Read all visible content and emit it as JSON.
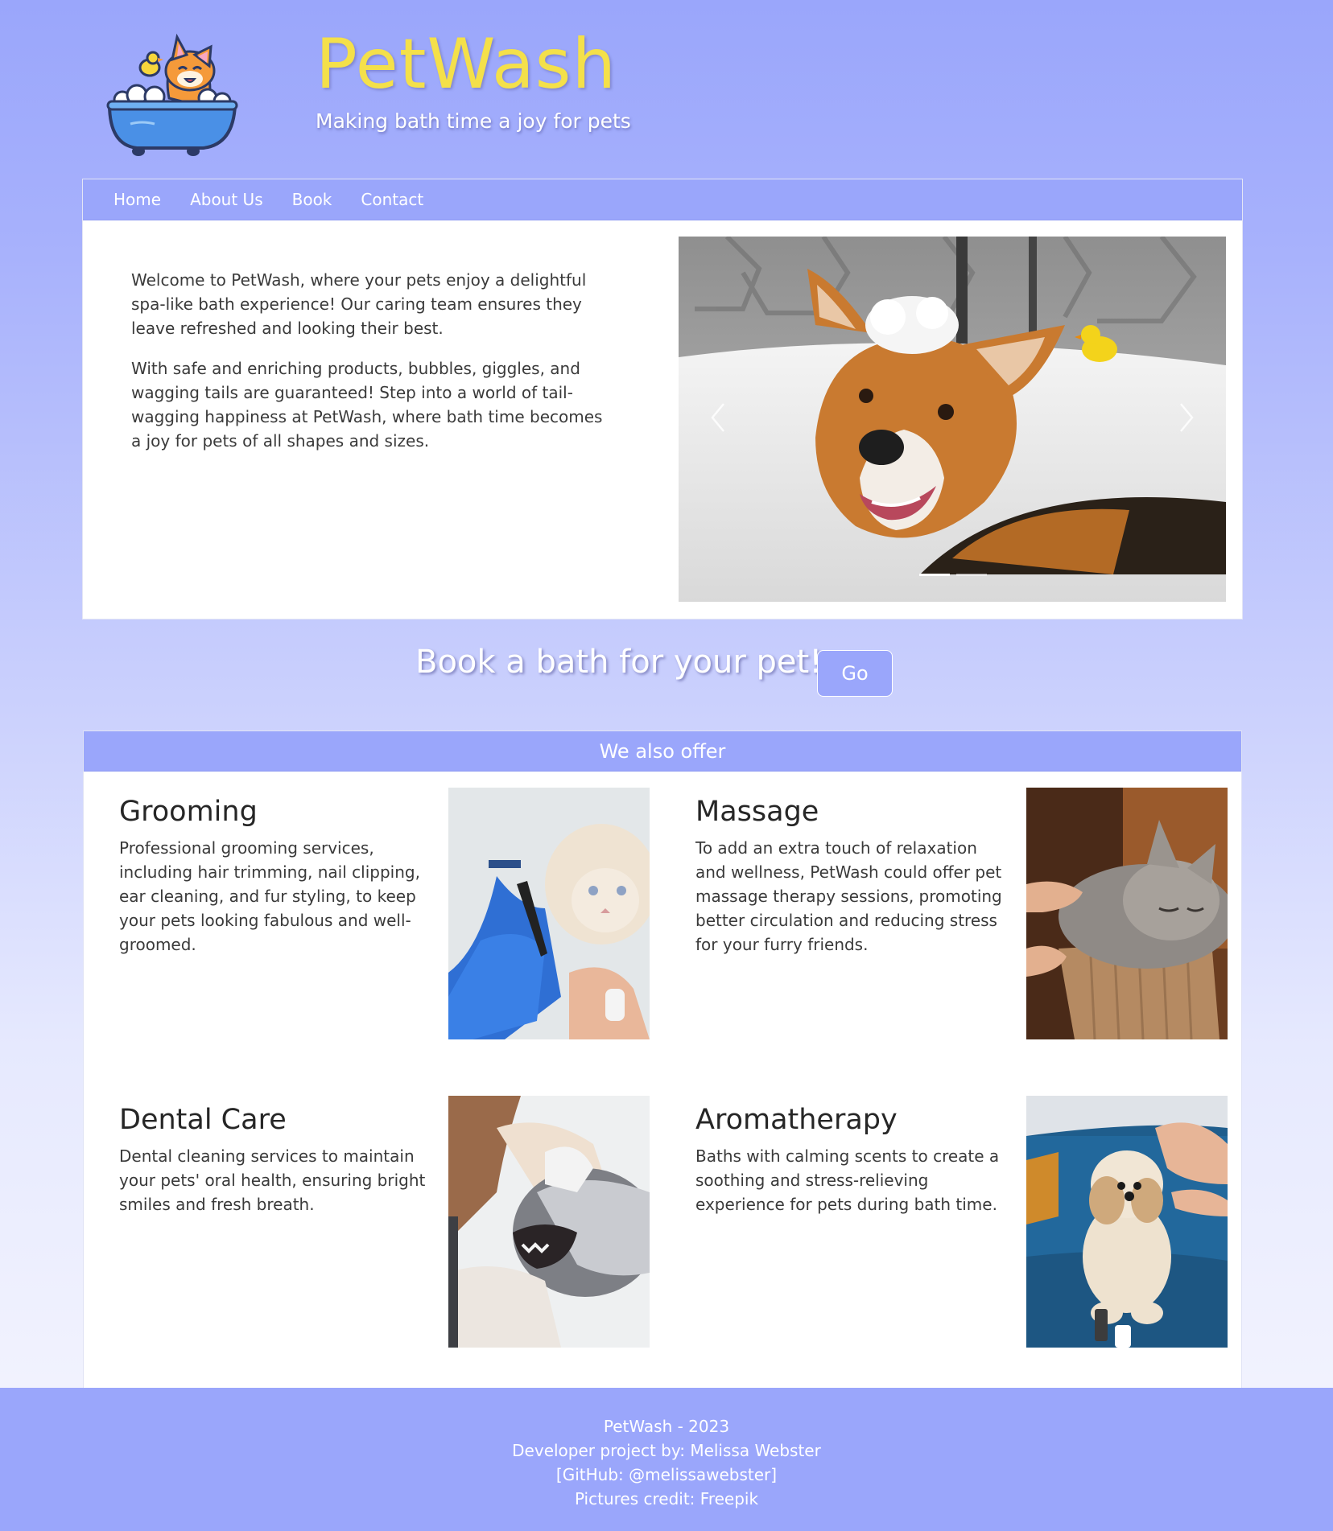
{
  "header": {
    "title": "PetWash",
    "tagline": "Making bath time a joy for pets"
  },
  "nav": {
    "items": [
      {
        "label": "Home"
      },
      {
        "label": "About Us"
      },
      {
        "label": "Book"
      },
      {
        "label": "Contact"
      }
    ]
  },
  "hero": {
    "paragraphs": [
      "Welcome to PetWash, where your pets enjoy a delightful spa-like bath experience! Our caring team ensures they leave refreshed and looking their best.",
      "With safe and enriching products, bubbles, giggles, and wagging tails are guaranteed! Step into a world of tail-wagging happiness at PetWash, where bath time becomes a joy for pets of all shapes and sizes."
    ],
    "carousel": {
      "image": "corgi-in-bath-photo",
      "slide_count": 2,
      "active_slide": 1
    }
  },
  "cta": {
    "text": "Book a bath for your pet!",
    "button_label": "Go"
  },
  "offers": {
    "heading": "We also offer",
    "services": [
      {
        "title": "Grooming",
        "description": "Professional grooming services, including hair trimming, nail clipping, ear cleaning, and fur styling, to keep your pets looking fabulous and well-groomed.",
        "image": "cat-nail-clipping-photo"
      },
      {
        "title": "Massage",
        "description": "To add an extra touch of relaxation and wellness, PetWash could offer pet massage therapy sessions, promoting better circulation and reducing stress for your furry friends.",
        "image": "cat-massage-photo"
      },
      {
        "title": "Dental Care",
        "description": "Dental cleaning services to maintain your pets' oral health, ensuring bright smiles and fresh breath.",
        "image": "dog-dental-check-photo"
      },
      {
        "title": "Aromatherapy",
        "description": "Baths with calming scents to create a soothing and stress-relieving experience for pets during bath time.",
        "image": "dog-on-sofa-photo"
      }
    ]
  },
  "footer": {
    "lines": [
      "PetWash - 2023",
      "Developer project by: Melissa Webster",
      "[GitHub: @melissawebster]",
      "Pictures credit: Freepik"
    ]
  },
  "colors": {
    "primary": "#9aa6fb",
    "title_yellow": "#f4e04a",
    "white": "#ffffff",
    "text": "#3a3a3a"
  }
}
